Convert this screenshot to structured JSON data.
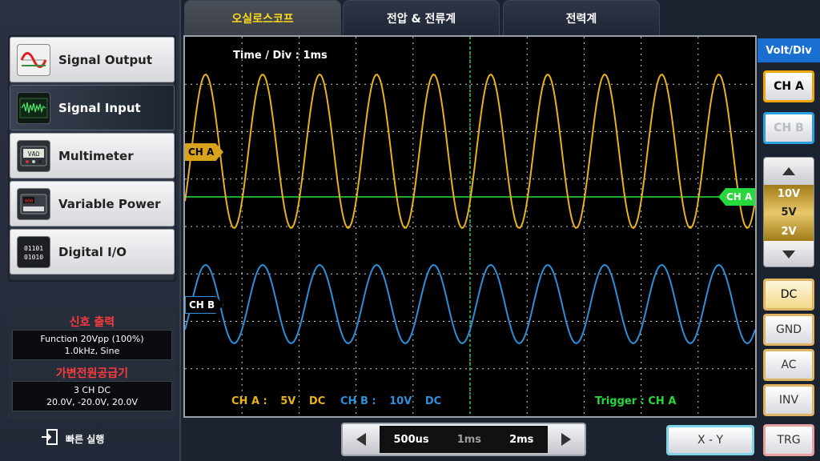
{
  "sidebar": {
    "items": [
      {
        "label": "Signal Output",
        "icon": "sine-wave-icon"
      },
      {
        "label": "Signal Input",
        "icon": "waveform-screen-icon"
      },
      {
        "label": "Multimeter",
        "icon": "multimeter-icon"
      },
      {
        "label": "Variable Power",
        "icon": "power-supply-icon"
      },
      {
        "label": "Digital I/O",
        "icon": "binary-icon"
      }
    ],
    "active_index": 1
  },
  "status": {
    "signal_output_title": "신호 출력",
    "signal_output_line1": "Function 20Vpp (100%)",
    "signal_output_line2": "1.0kHz, Sine",
    "power_title": "가변전원공급기",
    "power_line1": "3 CH DC",
    "power_line2": "20.0V, -20.0V, 20.0V"
  },
  "quick_run": {
    "label": "빠른 실행"
  },
  "tabs": [
    {
      "label": "오실로스코프"
    },
    {
      "label": "전압 & 전류계"
    },
    {
      "label": "전력계"
    }
  ],
  "active_tab": 0,
  "scope": {
    "time_div_label": "Time / Div : 1ms",
    "ch_a_marker": "CH A",
    "ch_b_marker": "CH B",
    "trigger_marker": "CH A",
    "ch_a_info_label": "CH A :",
    "ch_a_info_scale": "5V",
    "ch_a_info_coupling": "DC",
    "ch_b_info_label": "CH B :",
    "ch_b_info_scale": "10V",
    "ch_b_info_coupling": "DC",
    "trigger_label": "Trigger : CH A"
  },
  "right_panel": {
    "volt_div_label": "Volt/Div",
    "ch_a_button": "CH A",
    "ch_b_button": "CH B",
    "volt_options": [
      "10V",
      "5V",
      "2V"
    ],
    "volt_selected": "5V",
    "coupling_buttons": [
      "DC",
      "GND",
      "AC"
    ],
    "coupling_selected": "DC",
    "inv_button": "INV",
    "trg_button": "TRG"
  },
  "time_control": {
    "options": [
      "500us",
      "1ms",
      "2ms"
    ],
    "selected": "1ms"
  },
  "xy_button": "X - Y",
  "colors": {
    "ch_a": "#e8b21a",
    "ch_b": "#2f8fd8",
    "trigger": "#27d83c",
    "active_tab_text": "#ffd91a",
    "volt_div_bg": "#1a6fd0",
    "status_title": "#ff3b3b"
  }
}
